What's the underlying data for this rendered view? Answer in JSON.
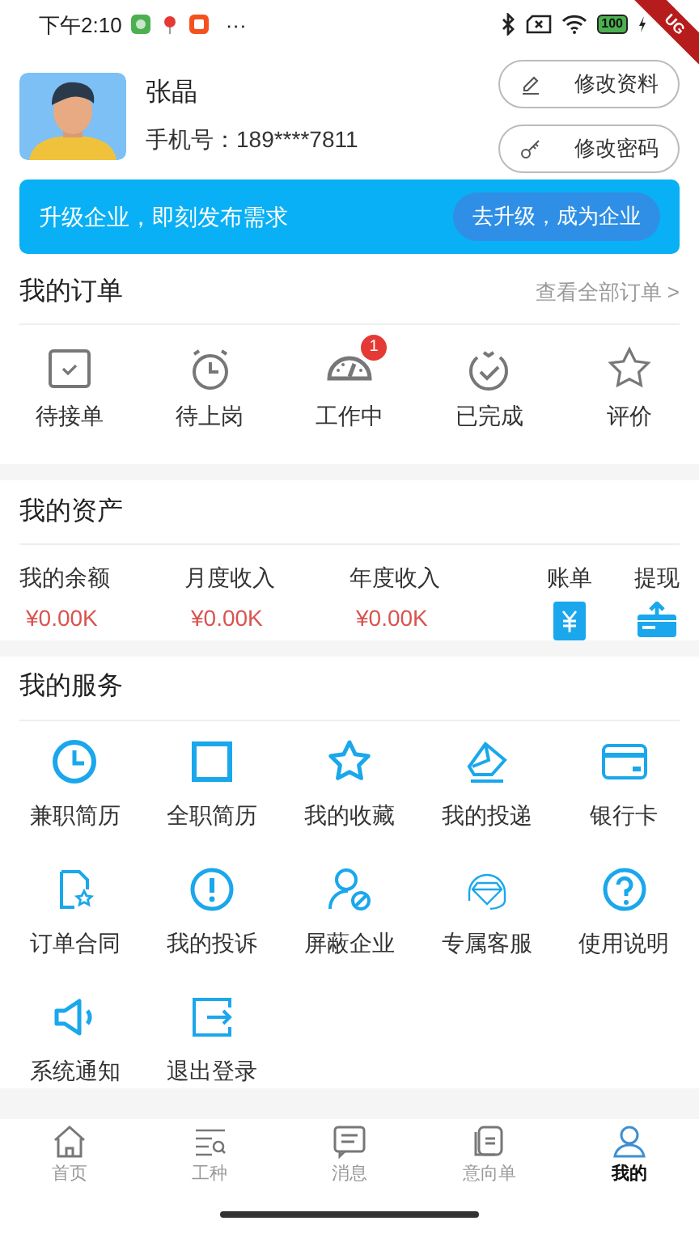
{
  "status_bar": {
    "time": "下午2:10",
    "more": "···",
    "battery": "100"
  },
  "debug_banner": "UG",
  "profile": {
    "name": "张晶",
    "phone": "手机号：189****7811",
    "buttons": [
      "修改资料",
      "修改密码"
    ]
  },
  "banner": {
    "text": "升级企业，即刻发布需求",
    "button": "去升级，成为企业"
  },
  "orders": {
    "title": "我的订单",
    "link": "查看全部订单 >",
    "items": [
      {
        "label": "待接单"
      },
      {
        "label": "待上岗"
      },
      {
        "label": "工作中",
        "badge": "1"
      },
      {
        "label": "已完成"
      },
      {
        "label": "评价"
      }
    ]
  },
  "assets": {
    "title": "我的资产",
    "stats": [
      {
        "label": "我的余额",
        "value": "¥0.00K"
      },
      {
        "label": "月度收入",
        "value": "¥0.00K"
      },
      {
        "label": "年度收入",
        "value": "¥0.00K"
      }
    ],
    "actions": [
      {
        "label": "账单"
      },
      {
        "label": "提现"
      }
    ]
  },
  "services": {
    "title": "我的服务",
    "items": [
      {
        "label": "兼职简历"
      },
      {
        "label": "全职简历"
      },
      {
        "label": "我的收藏"
      },
      {
        "label": "我的投递"
      },
      {
        "label": "银行卡"
      },
      {
        "label": "订单合同"
      },
      {
        "label": "我的投诉"
      },
      {
        "label": "屏蔽企业"
      },
      {
        "label": "专属客服"
      },
      {
        "label": "使用说明"
      },
      {
        "label": "系统通知"
      },
      {
        "label": "退出登录"
      }
    ]
  },
  "tab_bar": [
    {
      "label": "首页",
      "selected": false
    },
    {
      "label": "工种",
      "selected": false
    },
    {
      "label": "消息",
      "selected": false
    },
    {
      "label": "意向单",
      "selected": false
    },
    {
      "label": "我的",
      "selected": true
    }
  ]
}
